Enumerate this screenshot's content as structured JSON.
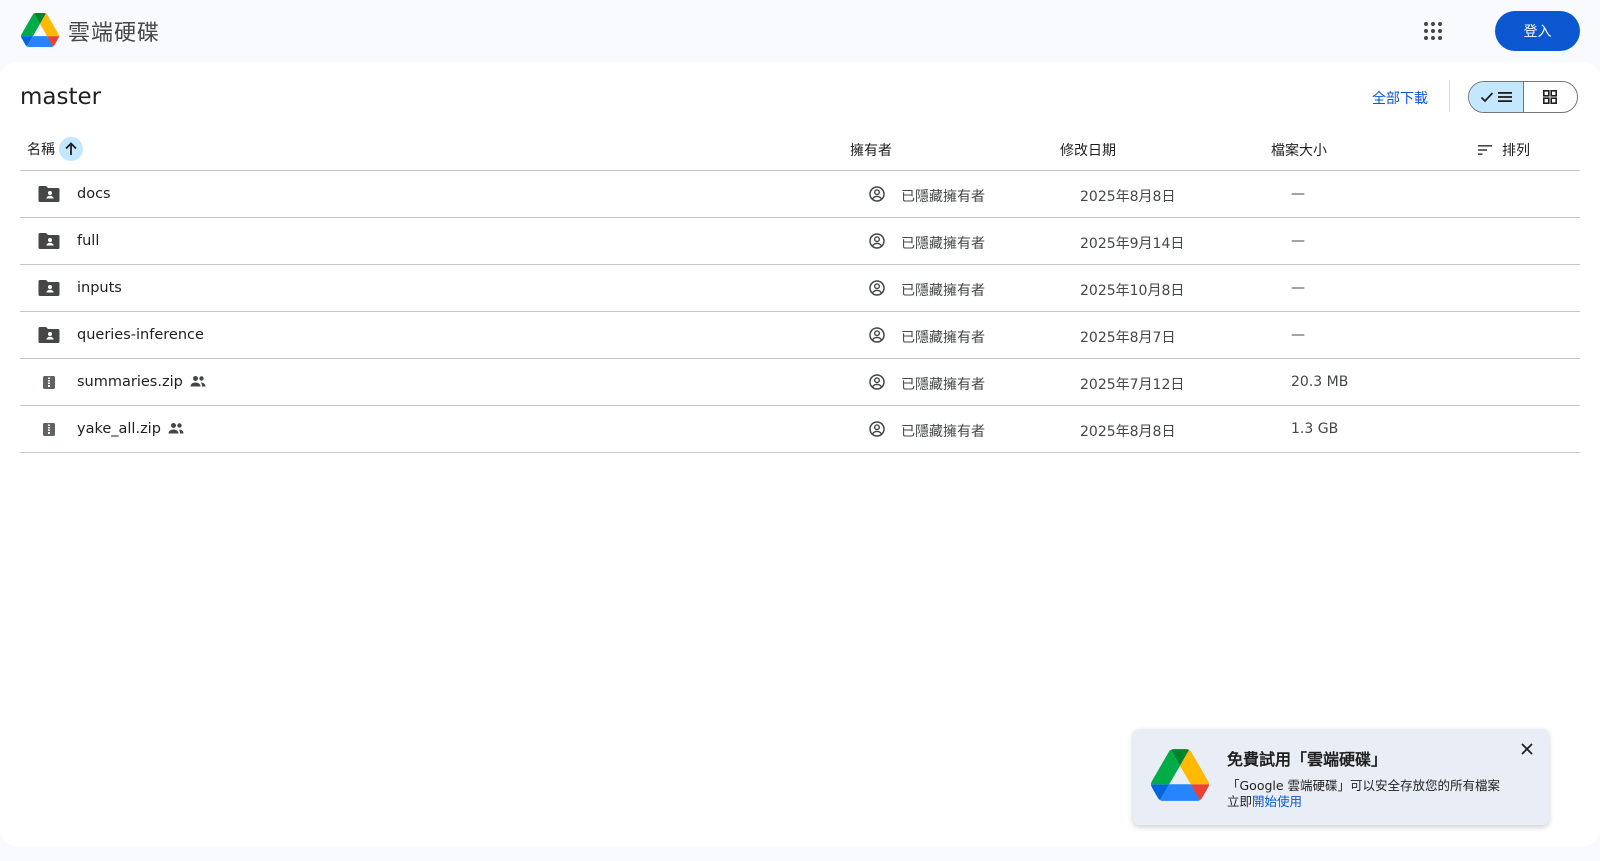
{
  "header": {
    "app_title": "雲端硬碟",
    "apps_icon": "apps-grid-icon",
    "signin_label": "登入"
  },
  "folder": {
    "title": "master",
    "download_all_label": "全部下載",
    "view_mode": "list"
  },
  "columns": {
    "name": "名稱",
    "owner": "擁有者",
    "modified": "修改日期",
    "size": "檔案大小",
    "sort_label": "排列",
    "name_sort_direction": "ascending"
  },
  "files": [
    {
      "name": "docs",
      "type": "shared-folder",
      "shared": false,
      "owner": "已隱藏擁有者",
      "modified": "2025年8月8日",
      "size": "—"
    },
    {
      "name": "full",
      "type": "shared-folder",
      "shared": false,
      "owner": "已隱藏擁有者",
      "modified": "2025年9月14日",
      "size": "—"
    },
    {
      "name": "inputs",
      "type": "shared-folder",
      "shared": false,
      "owner": "已隱藏擁有者",
      "modified": "2025年10月8日",
      "size": "—"
    },
    {
      "name": "queries-inference",
      "type": "shared-folder",
      "shared": false,
      "owner": "已隱藏擁有者",
      "modified": "2025年8月7日",
      "size": "—"
    },
    {
      "name": "summaries.zip",
      "type": "zip",
      "shared": true,
      "owner": "已隱藏擁有者",
      "modified": "2025年7月12日",
      "size": "20.3 MB"
    },
    {
      "name": "yake_all.zip",
      "type": "zip",
      "shared": true,
      "owner": "已隱藏擁有者",
      "modified": "2025年8月8日",
      "size": "1.3 GB"
    }
  ],
  "promo": {
    "title": "免費試用「雲端硬碟」",
    "description": "「Google 雲端硬碟」可以安全存放您的所有檔案",
    "cta_prefix": "立即",
    "cta_link": "開始使用"
  },
  "colors": {
    "accent": "#0b57d0",
    "selected_bg": "#c2e7ff",
    "page_bg": "#f8fafd",
    "promo_bg": "#e9eef6"
  }
}
